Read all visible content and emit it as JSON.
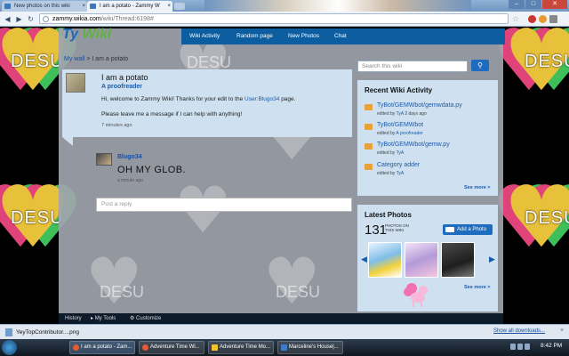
{
  "browser": {
    "tabs": [
      {
        "label": "New photos on this wiki",
        "active": false
      },
      {
        "label": "I am a potato - Zammy W",
        "active": true
      }
    ],
    "url_host": "zammy.wikia.com",
    "url_path": "/wiki/Thread:6198#",
    "window_buttons": {
      "minimize": "–",
      "maximize": "□",
      "close": "✕"
    }
  },
  "background": {
    "desu_text": "DESU"
  },
  "wiki": {
    "logo": {
      "part1": "Ty",
      "part2": "Wiki"
    },
    "nav": [
      "Wiki Activity",
      "Random page",
      "New Photos",
      "Chat"
    ],
    "breadcrumb": {
      "link": "My wall",
      "separator": ">",
      "current": "I am a potato"
    },
    "thread": {
      "title": "I am a potato",
      "author": "A proofreader",
      "body_pre": "Hi, welcome to Zammy Wiki! Thanks for your edit to the ",
      "body_link": "User:Blugo34",
      "body_post": " page.",
      "body2": "Please leave me a message if I can help with anything!",
      "time": "7 minutes ago"
    },
    "reply": {
      "author": "Blugo34",
      "text": "OH MY GLOB.",
      "time": "a minute ago"
    },
    "reply_placeholder": "Post a reply",
    "search_placeholder": "Search this wiki",
    "activity": {
      "heading": "Recent Wiki Activity",
      "items": [
        {
          "title": "TyBot/GEMWbot/gemwdata.py",
          "meta_pre": "edited by ",
          "who": "TyA",
          "meta_post": " 2 days ago"
        },
        {
          "title": "TyBot/GEMWbot",
          "meta_pre": "edited by ",
          "who": "A proofreader",
          "meta_post": ""
        },
        {
          "title": "TyBot/GEMWbot/gemw.py",
          "meta_pre": "edited by ",
          "who": "TyA",
          "meta_post": ""
        },
        {
          "title": "Category adder",
          "meta_pre": "edited by ",
          "who": "TyA",
          "meta_post": ""
        }
      ],
      "see_more": "See more >"
    },
    "photos": {
      "heading": "Latest Photos",
      "count": "131",
      "caption": "PHOTOS ON THIS WIKI",
      "add_label": "Add a Photo",
      "see_more": "See more >"
    },
    "footer": {
      "history": "History",
      "mytools": "My Tools",
      "customize": "Customize"
    }
  },
  "downloads": {
    "item": "YeyTopContributor....png",
    "show_all": "Show all downloads...",
    "close": "×"
  },
  "taskbar": {
    "items": [
      {
        "label": "I am a potato - Zam...",
        "color": "#e35b34"
      },
      {
        "label": "Adventure Time Wi...",
        "color": "#e35b34"
      },
      {
        "label": "Adventure Time Mo...",
        "color": "#f2c230"
      },
      {
        "label": "Marceline's House|...",
        "color": "#3d7cc9"
      }
    ],
    "clock": "8:42 PM"
  }
}
